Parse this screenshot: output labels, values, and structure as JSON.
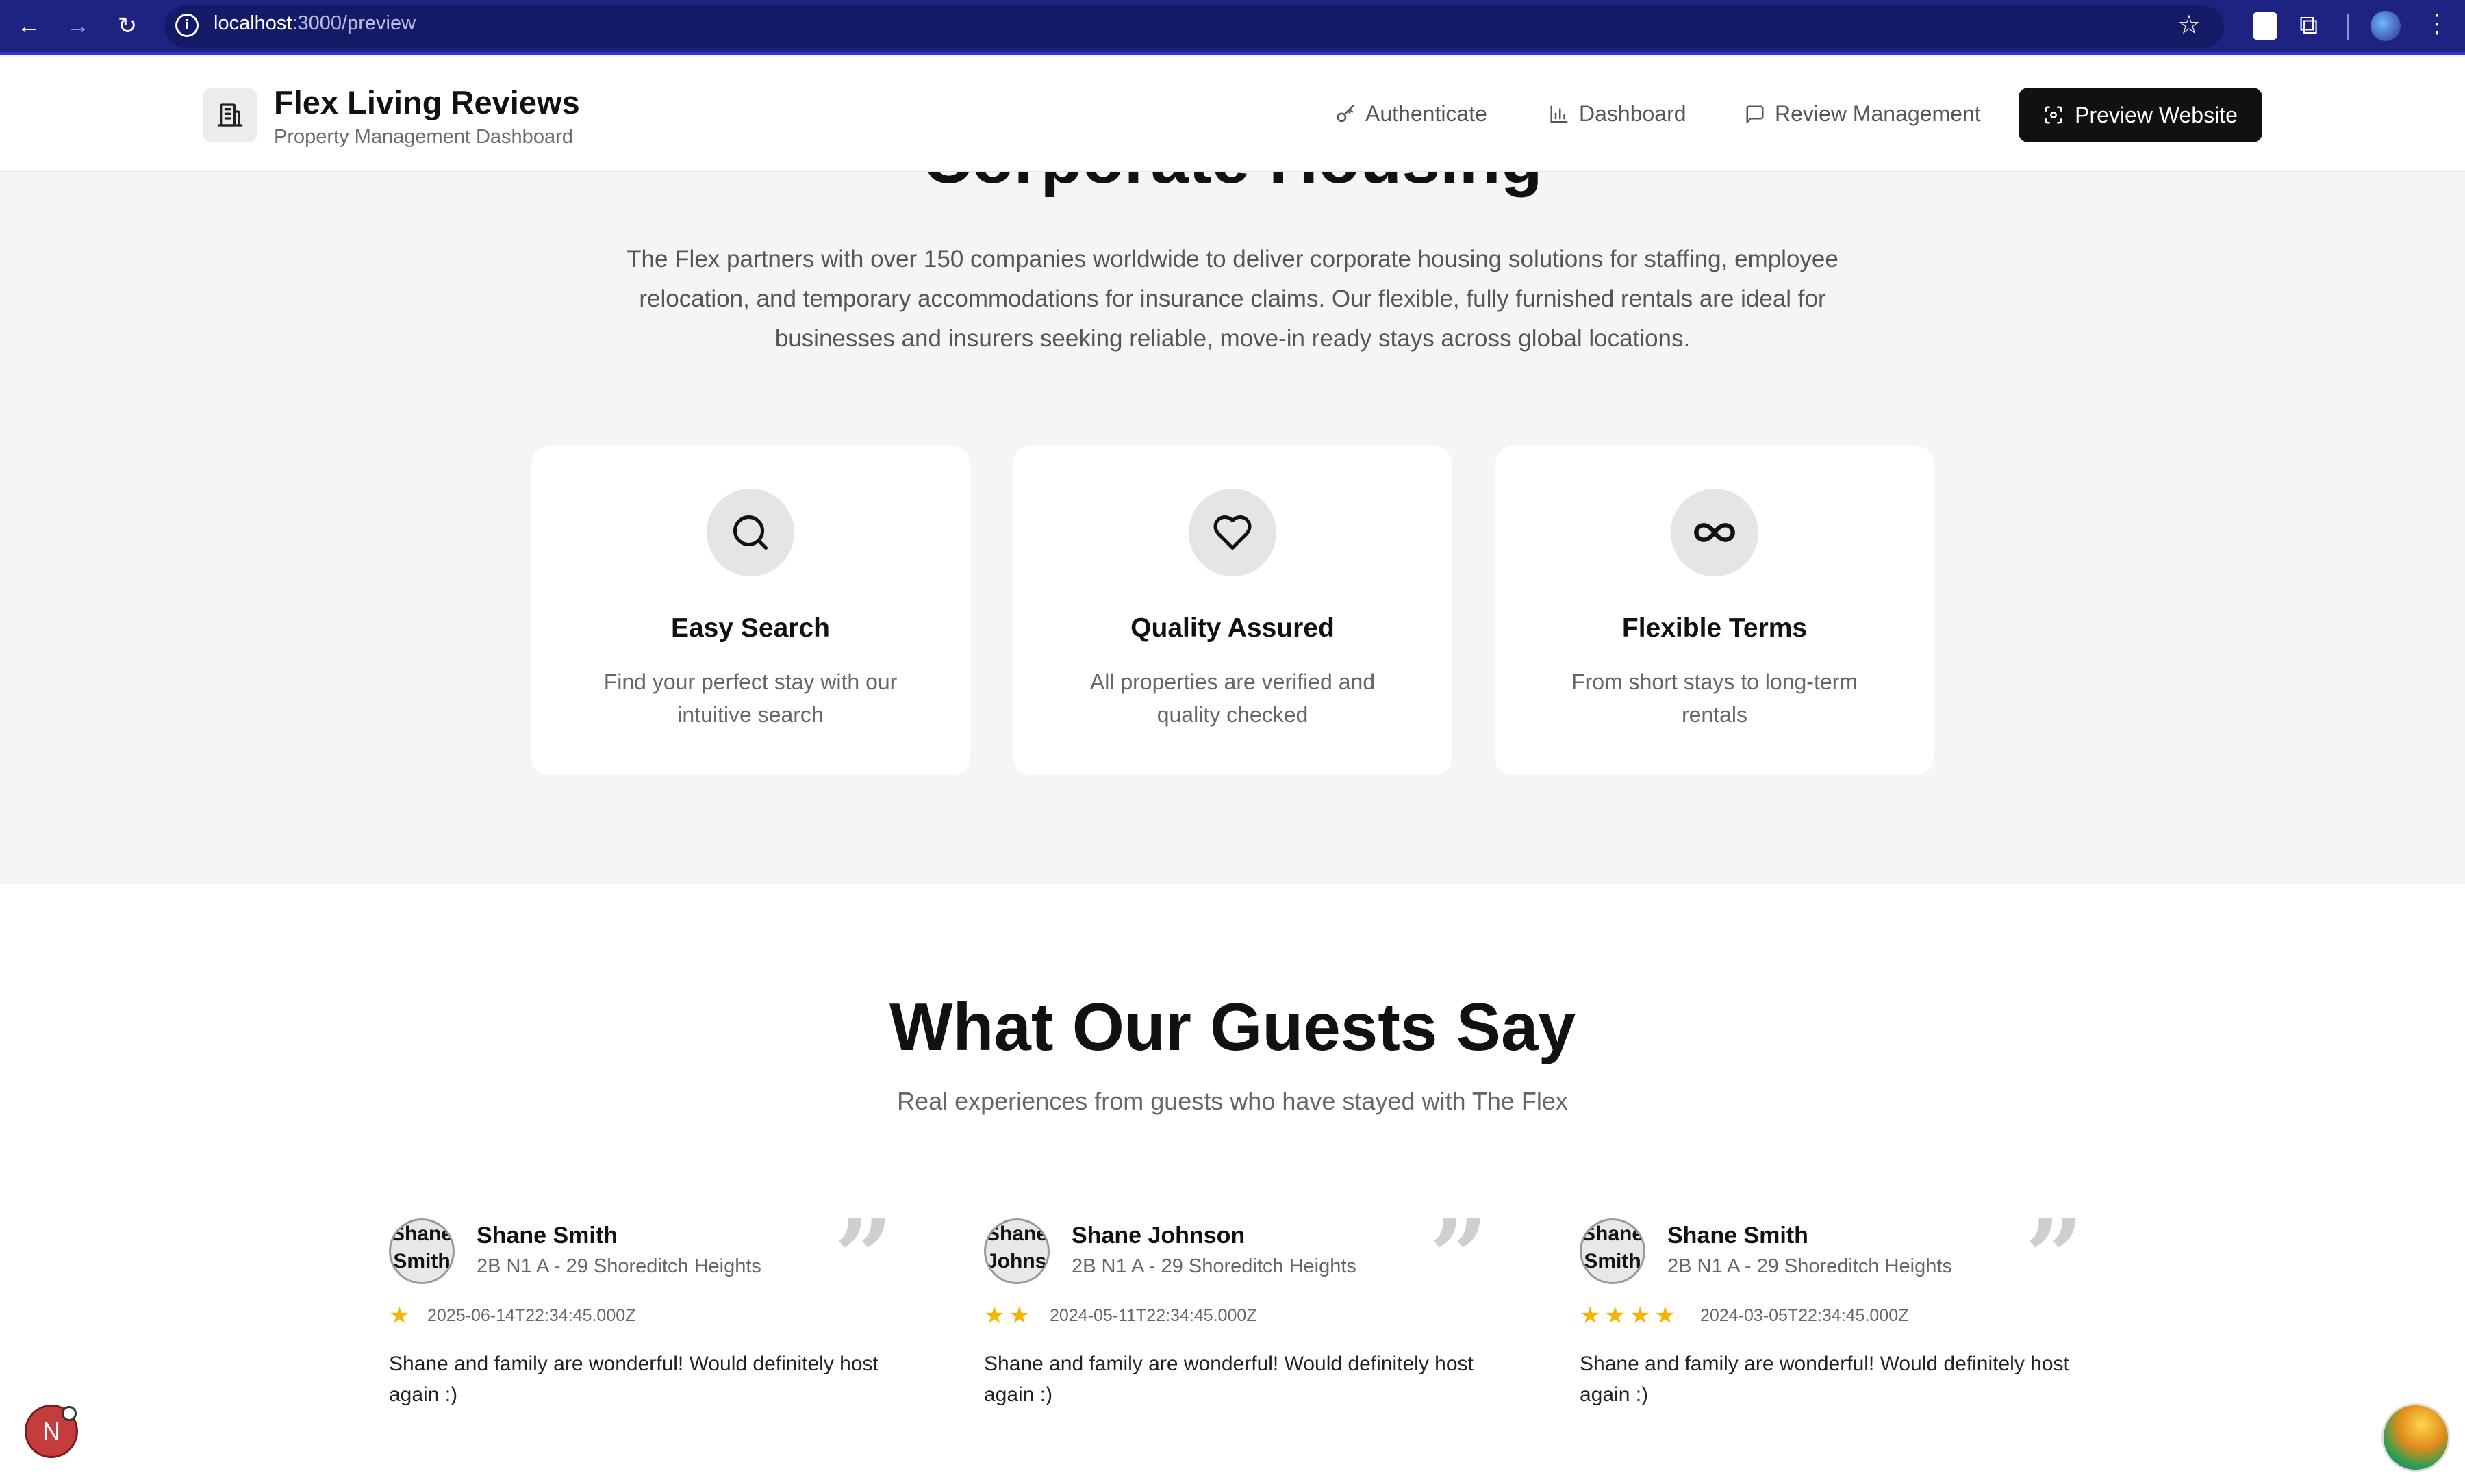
{
  "browser": {
    "url_host": "localhost",
    "url_path": ":3000/preview",
    "back_glyph": "←",
    "forward_glyph": "→",
    "reload_glyph": "↻",
    "star_glyph": "☆",
    "menu_glyph": "⋮"
  },
  "header": {
    "title": "Flex Living Reviews",
    "subtitle": "Property Management Dashboard",
    "nav": [
      {
        "label": "Authenticate",
        "icon": "key-icon"
      },
      {
        "label": "Dashboard",
        "icon": "bar-chart-icon"
      },
      {
        "label": "Review Management",
        "icon": "message-square-icon"
      }
    ],
    "preview_button": "Preview Website"
  },
  "corporate": {
    "title": "Corporate Housing",
    "text": "The Flex partners with over 150 companies worldwide to deliver corporate housing solutions for staffing, employee relocation, and temporary accommodations for insurance claims. Our flexible, fully furnished rentals are ideal for businesses and insurers seeking reliable, move-in ready stays across global locations."
  },
  "features": [
    {
      "icon": "search-icon",
      "title": "Easy Search",
      "desc": "Find your perfect stay with our intuitive search"
    },
    {
      "icon": "heart-icon",
      "title": "Quality Assured",
      "desc": "All properties are verified and quality checked"
    },
    {
      "icon": "infinity-icon",
      "title": "Flexible Terms",
      "desc": "From short stays to long-term rentals"
    }
  ],
  "guests": {
    "title": "What Our Guests Say",
    "subtitle": "Real experiences from guests who have stayed with The Flex"
  },
  "reviews": [
    {
      "avatar_text": "Shane Smith",
      "name": "Shane Smith",
      "property": "2B N1 A - 29 Shoreditch Heights",
      "rating": 1,
      "date": "2025-06-14T22:34:45.000Z",
      "text": "Shane and family are wonderful! Would definitely host again :)"
    },
    {
      "avatar_text": "Shane Johnson",
      "name": "Shane Johnson",
      "property": "2B N1 A - 29 Shoreditch Heights",
      "rating": 2,
      "date": "2024-05-11T22:34:45.000Z",
      "text": "Shane and family are wonderful! Would definitely host again :)"
    },
    {
      "avatar_text": "Shane Smith",
      "name": "Shane Smith",
      "property": "2B N1 A - 29 Shoreditch Heights",
      "rating": 4,
      "date": "2024-03-05T22:34:45.000Z",
      "text": "Shane and family are wonderful! Would definitely host again :)"
    }
  ],
  "quote_glyph": "”",
  "dev_badge": "N",
  "colors": {
    "browser_bar": "#1e2382",
    "star": "#f5b400",
    "primary_button": "#111111"
  }
}
